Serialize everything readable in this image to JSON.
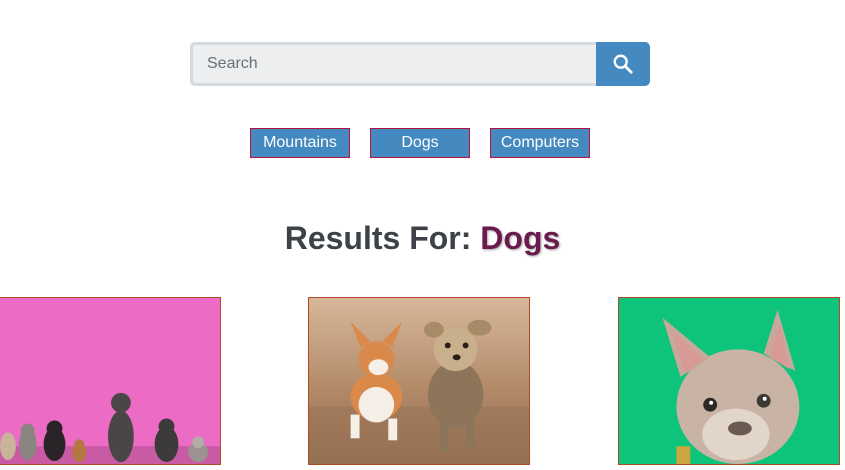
{
  "search": {
    "placeholder": "Search",
    "button_icon": "search-icon"
  },
  "categories": [
    {
      "label": "Mountains"
    },
    {
      "label": "Dogs"
    },
    {
      "label": "Computers"
    }
  ],
  "results": {
    "prefix": "Results For: ",
    "term": "Dogs"
  },
  "images": [
    {
      "subject": "dogs-pink-wall-photo"
    },
    {
      "subject": "corgi-and-yorkie-running-photo"
    },
    {
      "subject": "french-bulldog-green-photo"
    }
  ],
  "colors": {
    "accent": "#4489bf",
    "button_border": "#b3123a",
    "heading": "#3d4248",
    "term": "#6a1a4c"
  }
}
